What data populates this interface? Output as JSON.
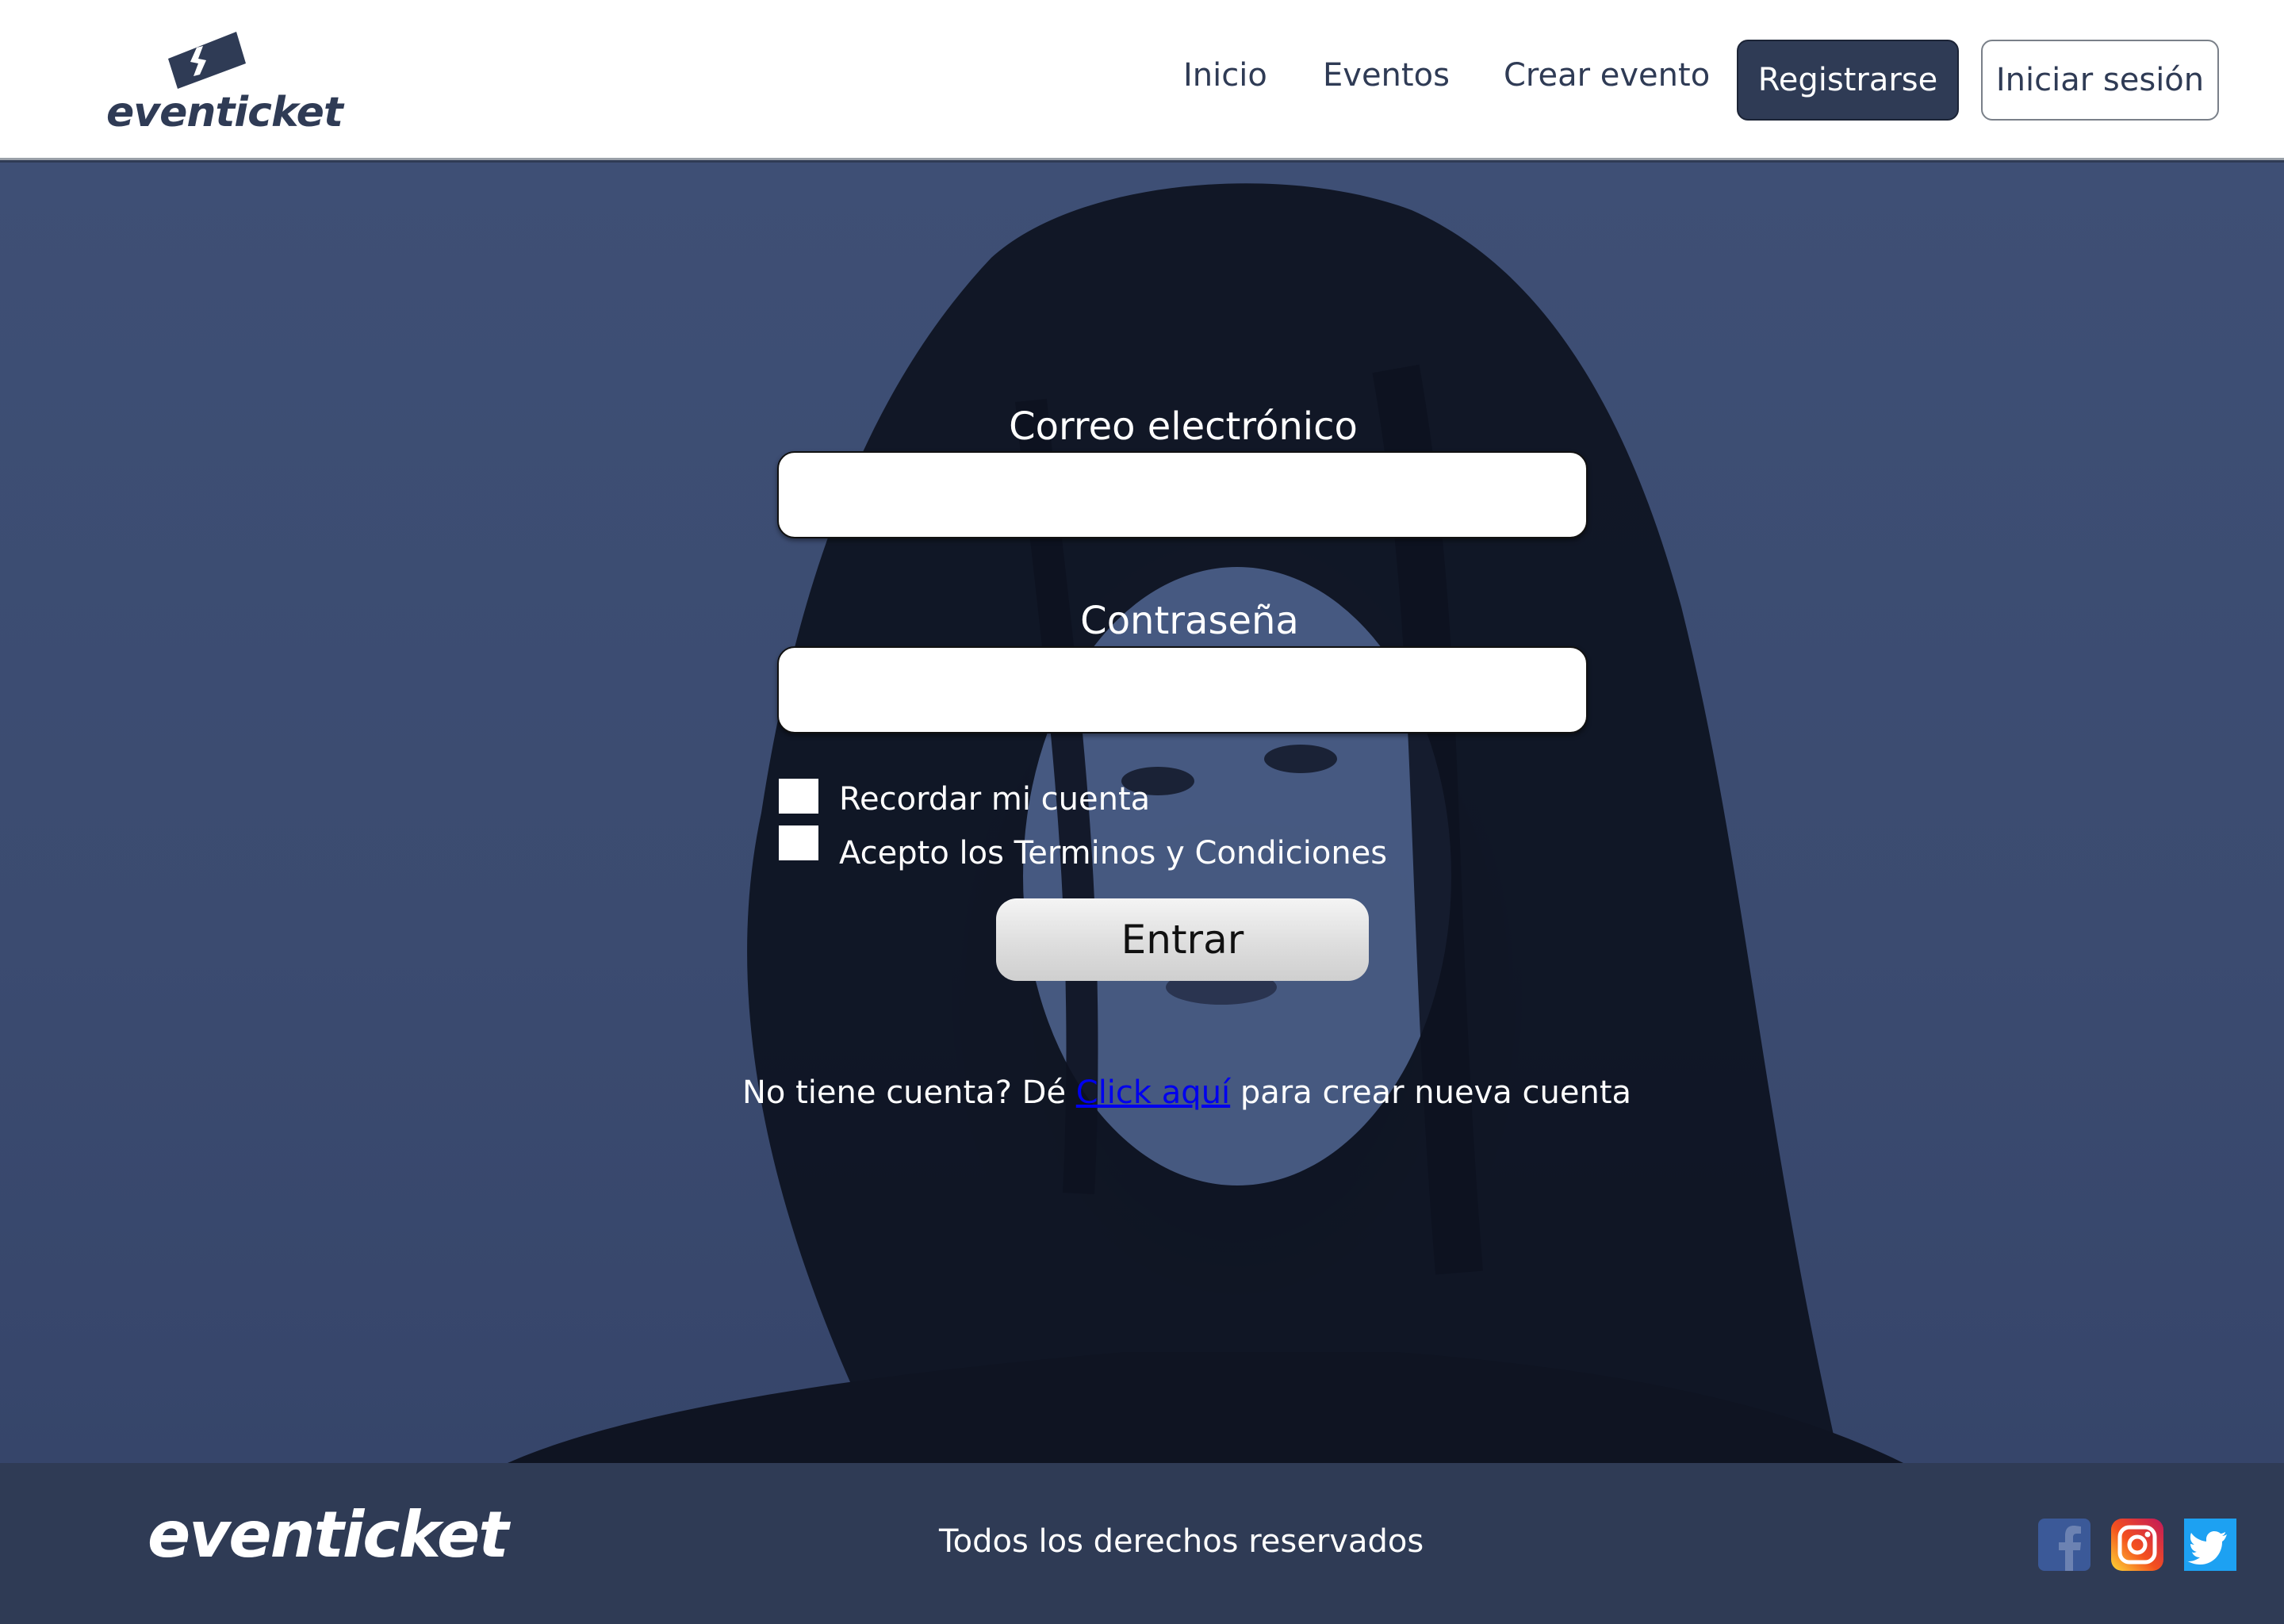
{
  "header": {
    "logo_text": "eventicket",
    "nav": {
      "inicio": "Inicio",
      "eventos": "Eventos",
      "crear_evento": "Crear evento"
    },
    "register_button": "Registrarse",
    "login_button": "Iniciar sesión"
  },
  "form": {
    "email_label": "Correo electrónico",
    "email_value": "",
    "password_label": "Contraseña",
    "password_value": "",
    "remember_label": "Recordar mi cuenta",
    "terms_label": "Acepto los Terminos y Condiciones",
    "submit_label": "Entrar",
    "signup_prefix": "No tiene cuenta? Dé ",
    "signup_link": "Click aquí",
    "signup_suffix": " para crear nueva cuenta"
  },
  "footer": {
    "logo_text": "eventicket",
    "copyright": "Todos los derechos reservados",
    "social": [
      "facebook-icon",
      "instagram-icon",
      "twitter-icon"
    ]
  },
  "colors": {
    "brand_navy": "#2f3b55",
    "hero_overlay": "#3e4f75",
    "link_blue": "#0000ee",
    "facebook": "#3b5998",
    "twitter": "#1da1f2"
  }
}
